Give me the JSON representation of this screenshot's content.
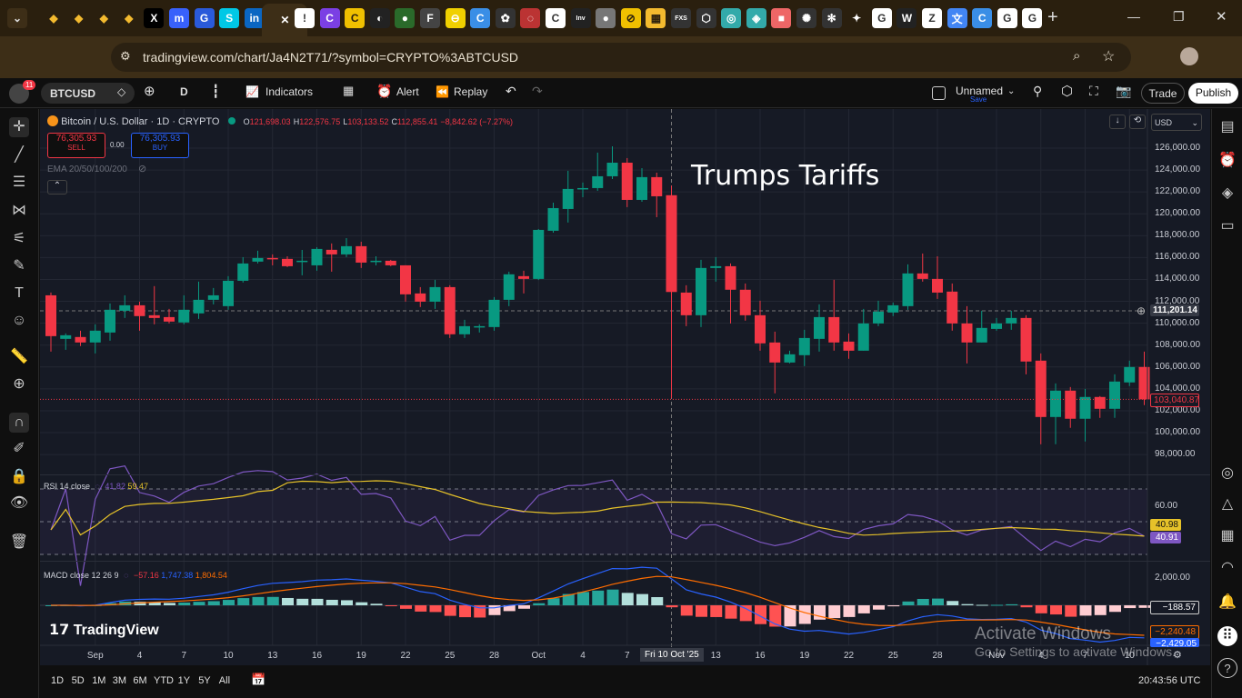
{
  "browser": {
    "tabs": [
      {
        "icon": "binance-icon",
        "g": "◆",
        "c": "#f3ba2f"
      },
      {
        "icon": "binance-icon",
        "g": "◆",
        "c": "#f3ba2f"
      },
      {
        "icon": "binance-icon",
        "g": "◆",
        "c": "#f3ba2f"
      },
      {
        "icon": "binance-icon",
        "g": "◆",
        "c": "#f3ba2f"
      },
      {
        "icon": "x-icon",
        "g": "X",
        "c": "#000"
      },
      {
        "icon": "coinmarketcap-icon",
        "g": "m",
        "c": "#3861fb"
      },
      {
        "icon": "coingecko-icon",
        "g": "G",
        "c": "#2a5ada"
      },
      {
        "icon": "bitget-icon",
        "g": "S",
        "c": "#00c8e6"
      },
      {
        "icon": "linkedin-icon",
        "g": "in",
        "c": "#0a66c2"
      },
      {
        "icon": "close-icon",
        "g": "✕",
        "c": "transparent",
        "active": true
      },
      {
        "icon": "site-icon",
        "g": "!",
        "c": "#fff"
      },
      {
        "icon": "site-icon",
        "g": "C",
        "c": "#7b3fe4"
      },
      {
        "icon": "site-icon",
        "g": "C",
        "c": "#f0c000"
      },
      {
        "icon": "site-icon",
        "g": "◐",
        "c": "#222"
      },
      {
        "icon": "site-icon",
        "g": "●",
        "c": "#2a6a2a"
      },
      {
        "icon": "site-icon",
        "g": "F",
        "c": "#444"
      },
      {
        "icon": "site-icon",
        "g": "⊖",
        "c": "#f0d000"
      },
      {
        "icon": "site-icon",
        "g": "C",
        "c": "#3a8ee6"
      },
      {
        "icon": "openai-icon",
        "g": "✿",
        "c": "#333"
      },
      {
        "icon": "site-icon",
        "g": "◌",
        "c": "#b33"
      },
      {
        "icon": "site-icon",
        "g": "C",
        "c": "#fff"
      },
      {
        "icon": "investing-icon",
        "g": "Inv",
        "c": "#222"
      },
      {
        "icon": "site-icon",
        "g": "●",
        "c": "#777"
      },
      {
        "icon": "site-icon",
        "g": "⊘",
        "c": "#f0c000"
      },
      {
        "icon": "site-icon",
        "g": "▦",
        "c": "#f3ba2f"
      },
      {
        "icon": "fxs-icon",
        "g": "FXS",
        "c": "#333"
      },
      {
        "icon": "site-icon",
        "g": "⬡",
        "c": "#333"
      },
      {
        "icon": "site-icon",
        "g": "◎",
        "c": "#3aa"
      },
      {
        "icon": "site-icon",
        "g": "◈",
        "c": "#3aa"
      },
      {
        "icon": "site-icon",
        "g": "■",
        "c": "#e66"
      },
      {
        "icon": "site-icon",
        "g": "✺",
        "c": "#333"
      },
      {
        "icon": "site-icon",
        "g": "✻",
        "c": "#333"
      },
      {
        "icon": "gemini-icon",
        "g": "✦",
        "c": "transparent"
      },
      {
        "icon": "google-icon",
        "g": "G",
        "c": "#fff"
      },
      {
        "icon": "site-icon",
        "g": "W",
        "c": "#222"
      },
      {
        "icon": "site-icon",
        "g": "Z",
        "c": "#fff"
      },
      {
        "icon": "translate-icon",
        "g": "文",
        "c": "#4285f4"
      },
      {
        "icon": "site-icon",
        "g": "C",
        "c": "#3a8ee6"
      },
      {
        "icon": "google-icon",
        "g": "G",
        "c": "#fff"
      },
      {
        "icon": "google-icon",
        "g": "G",
        "c": "#fff"
      }
    ],
    "new_tab": "+",
    "url": "tradingview.com/chart/Ja4N2T71/?symbol=CRYPTO%3ABTCUSD"
  },
  "toolbar": {
    "notifications": "11",
    "symbol": "BTCUSD",
    "interval": "D",
    "indicators": "Indicators",
    "alert": "Alert",
    "replay": "Replay",
    "layout_name": "Unnamed",
    "save": "Save",
    "trade": "Trade",
    "publish": "Publish"
  },
  "legend": {
    "title": "Bitcoin / U.S. Dollar · 1D · CRYPTO",
    "o_label": "O",
    "o": "121,698.03",
    "h_label": "H",
    "h": "122,576.75",
    "l_label": "L",
    "l": "103,133.52",
    "c_label": "C",
    "c": "112,855.41",
    "change": "−8,842.62 (−7.27%)",
    "sell_price": "76,305.93",
    "sell": "SELL",
    "spread": "0.00",
    "buy_price": "76,305.93",
    "buy": "BUY",
    "ema": "EMA 20/50/100/200"
  },
  "currency": "USD",
  "annotation": "Trumps Tariffs",
  "crosshair": {
    "price": "111,201.14",
    "date": "Fri 10 Oct '25"
  },
  "last_price": "103,040.87",
  "rsi": {
    "label": "RSI 14 close",
    "v1": "41.82",
    "v2": "59.47",
    "axis": "60.00",
    "badge1": "40.98",
    "badge2": "40.91"
  },
  "macd": {
    "label": "MACD close 12 26 9",
    "v1": "−57.16",
    "v2": "1,747.38",
    "v3": "1,804.54",
    "axis": "2,000.00",
    "badge1": "−188.57",
    "badge2": "−2,240.48",
    "badge3": "−2,429.05"
  },
  "logo": "TradingView",
  "timeframes": [
    "1D",
    "5D",
    "1M",
    "3M",
    "6M",
    "YTD",
    "1Y",
    "5Y",
    "All"
  ],
  "clock": "20:43:56 UTC",
  "watermark": {
    "title": "Activate Windows",
    "sub": "Go to Settings to activate Windows."
  },
  "colors": {
    "up": "#089981",
    "down": "#f23645",
    "rsi": "#7e57c2",
    "rsi_ma": "#e6c229",
    "macd": "#2962ff",
    "signal": "#ff6d00",
    "bg": "#161a25"
  },
  "chart_data": {
    "type": "candlestick",
    "title": "Bitcoin / U.S. Dollar · 1D · CRYPTO",
    "ylim": [
      97000,
      127000
    ],
    "price_ticks": [
      126000,
      124000,
      122000,
      120000,
      118000,
      116000,
      114000,
      112000,
      110000,
      108000,
      106000,
      104000,
      102000,
      100000,
      98000
    ],
    "price_tick_labels": [
      "126,000.00",
      "124,000.00",
      "122,000.00",
      "120,000.00",
      "118,000.00",
      "116,000.00",
      "114,000.00",
      "112,000.00",
      "110,000.00",
      "108,000.00",
      "106,000.00",
      "104,000.00",
      "102,000.00",
      "100,000.00",
      "98,000.00"
    ],
    "time_ticks": [
      {
        "i": 3,
        "t": "Sep"
      },
      {
        "i": 6,
        "t": "4"
      },
      {
        "i": 9,
        "t": "7"
      },
      {
        "i": 12,
        "t": "10"
      },
      {
        "i": 15,
        "t": "13"
      },
      {
        "i": 18,
        "t": "16"
      },
      {
        "i": 21,
        "t": "19"
      },
      {
        "i": 24,
        "t": "22"
      },
      {
        "i": 27,
        "t": "25"
      },
      {
        "i": 30,
        "t": "28"
      },
      {
        "i": 33,
        "t": "Oct"
      },
      {
        "i": 36,
        "t": "4"
      },
      {
        "i": 39,
        "t": "7"
      },
      {
        "i": 45,
        "t": "13"
      },
      {
        "i": 48,
        "t": "16"
      },
      {
        "i": 51,
        "t": "19"
      },
      {
        "i": 54,
        "t": "22"
      },
      {
        "i": 57,
        "t": "25"
      },
      {
        "i": 60,
        "t": "28"
      },
      {
        "i": 64,
        "t": "Nov"
      },
      {
        "i": 67,
        "t": "4"
      },
      {
        "i": 70,
        "t": "7"
      },
      {
        "i": 73,
        "t": "10"
      }
    ],
    "ohlc": [
      [
        112550,
        112800,
        107410,
        108820
      ],
      [
        108570,
        109070,
        107570,
        108900
      ],
      [
        108740,
        109320,
        107910,
        108240
      ],
      [
        108240,
        109900,
        107240,
        109320
      ],
      [
        109150,
        111810,
        108400,
        111230
      ],
      [
        111140,
        112550,
        110480,
        111640
      ],
      [
        111640,
        111970,
        109320,
        110650
      ],
      [
        110730,
        113390,
        109900,
        110480
      ],
      [
        110560,
        111310,
        109980,
        110150
      ],
      [
        110070,
        112550,
        109900,
        111230
      ],
      [
        110900,
        113800,
        110400,
        112140
      ],
      [
        112140,
        113220,
        111720,
        112550
      ],
      [
        111560,
        114300,
        111230,
        113880
      ],
      [
        113880,
        116040,
        113720,
        115460
      ],
      [
        115630,
        116620,
        115460,
        115960
      ],
      [
        115960,
        116290,
        115290,
        115880
      ],
      [
        115880,
        116120,
        115130,
        115210
      ],
      [
        115630,
        116700,
        114380,
        115710
      ],
      [
        115290,
        116950,
        114800,
        116790
      ],
      [
        116710,
        117290,
        114710,
        116290
      ],
      [
        116290,
        117780,
        116040,
        117040
      ],
      [
        117040,
        117450,
        115050,
        115540
      ],
      [
        115630,
        116120,
        115290,
        115710
      ],
      [
        115710,
        115790,
        115210,
        115290
      ],
      [
        115290,
        115300,
        111970,
        112640
      ],
      [
        112720,
        113300,
        111480,
        111970
      ],
      [
        111970,
        113970,
        111310,
        113300
      ],
      [
        113300,
        113470,
        108650,
        108990
      ],
      [
        108990,
        110310,
        108650,
        109730
      ],
      [
        109650,
        109900,
        109150,
        109730
      ],
      [
        109650,
        112390,
        109320,
        112140
      ],
      [
        112140,
        114710,
        111560,
        114470
      ],
      [
        114300,
        114800,
        112720,
        114050
      ],
      [
        114050,
        118610,
        113950,
        118530
      ],
      [
        118450,
        121020,
        118280,
        120520
      ],
      [
        120440,
        123930,
        119200,
        122270
      ],
      [
        122270,
        122850,
        121520,
        122350
      ],
      [
        122350,
        125590,
        122100,
        123430
      ],
      [
        123430,
        126170,
        123180,
        124670
      ],
      [
        124670,
        125090,
        120610,
        121270
      ],
      [
        121270,
        124170,
        121100,
        123350
      ],
      [
        123350,
        123760,
        119690,
        121600
      ],
      [
        121698,
        122577,
        103134,
        112855
      ],
      [
        112800,
        113470,
        109730,
        110730
      ],
      [
        110730,
        115790,
        109650,
        115050
      ],
      [
        115050,
        116040,
        113800,
        115210
      ],
      [
        115210,
        115460,
        109980,
        113060
      ],
      [
        113060,
        113630,
        110230,
        110730
      ],
      [
        110730,
        112060,
        107490,
        108160
      ],
      [
        108240,
        109230,
        103590,
        106410
      ],
      [
        106410,
        107490,
        106330,
        107160
      ],
      [
        107080,
        109400,
        106080,
        108650
      ],
      [
        108570,
        111720,
        107410,
        110560
      ],
      [
        110560,
        113970,
        107490,
        108240
      ],
      [
        108320,
        109070,
        106750,
        107490
      ],
      [
        107490,
        111310,
        107490,
        109980
      ],
      [
        109980,
        112060,
        109730,
        111060
      ],
      [
        110980,
        111890,
        110650,
        111640
      ],
      [
        111560,
        115380,
        111230,
        114550
      ],
      [
        114550,
        116370,
        113800,
        114050
      ],
      [
        114050,
        116120,
        112220,
        112800
      ],
      [
        112890,
        113630,
        109320,
        109980
      ],
      [
        109980,
        111560,
        106330,
        108240
      ],
      [
        108240,
        111140,
        108240,
        109570
      ],
      [
        109480,
        110480,
        109320,
        109980
      ],
      [
        109980,
        111140,
        109400,
        110480
      ],
      [
        110480,
        110730,
        105330,
        106500
      ],
      [
        106580,
        107240,
        98940,
        101430
      ],
      [
        101430,
        104500,
        98940,
        103840
      ],
      [
        103840,
        104170,
        100440,
        101270
      ],
      [
        101270,
        104000,
        99190,
        103260
      ],
      [
        103260,
        103340,
        101350,
        102180
      ],
      [
        102180,
        105330,
        101350,
        104670
      ],
      [
        104590,
        106580,
        104260,
        106000
      ],
      [
        106000,
        107410,
        102520,
        103041
      ]
    ]
  }
}
